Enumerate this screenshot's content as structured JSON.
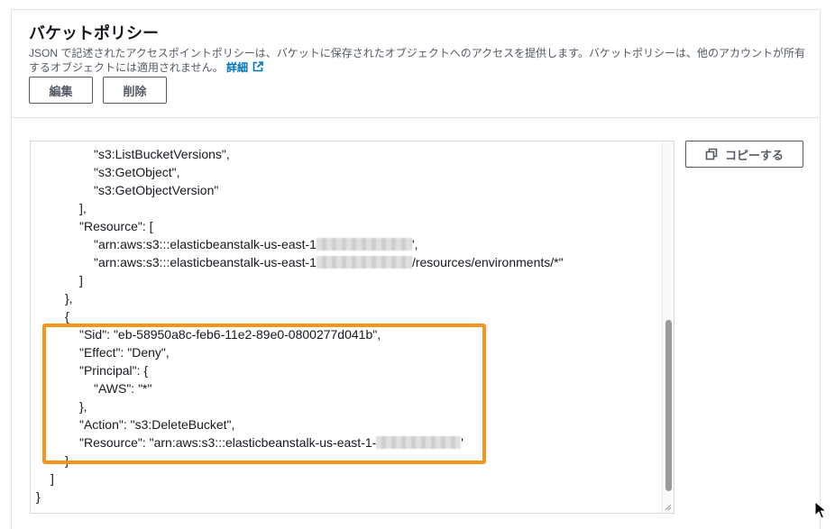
{
  "header": {
    "title": "バケットポリシー",
    "description": "JSON で記述されたアクセスポイントポリシーは、バケットに保存されたオブジェクトへのアクセスを提供します。バケットポリシーは、他のアカウントが所有するオブジェクトには適用されません。",
    "link_label": "詳細",
    "edit_label": "編集",
    "delete_label": "削除"
  },
  "toolbar": {
    "copy_label": "コピーする"
  },
  "icons": {
    "copy": "copy-icon",
    "external_link": "external-link-icon"
  },
  "colors": {
    "link": "#0073bb",
    "highlight": "#f7941d"
  },
  "editor": {
    "lines": [
      "\"s3:ListBucketVersions\",",
      "\"s3:GetObject\",",
      "\"s3:GetObjectVersion\"",
      "],",
      "\"Resource\": [",
      "\"arn:aws:s3:::elasticbeanstalk-us-east-1",
      "',",
      "\"arn:aws:s3:::elasticbeanstalk-us-east-1",
      "/resources/environments/*\"",
      "]",
      "},",
      "{",
      "\"Sid\": \"eb-58950a8c-feb6-11e2-89e0-0800277d041b\",",
      "\"Effect\": \"Deny\",",
      "\"Principal\": {",
      "\"AWS\": \"*\"",
      "},",
      "\"Action\": \"s3:DeleteBucket\",",
      "\"Resource\": \"arn:aws:s3:::elasticbeanstalk-us-east-1-",
      "'",
      "}",
      "]",
      "}"
    ]
  }
}
